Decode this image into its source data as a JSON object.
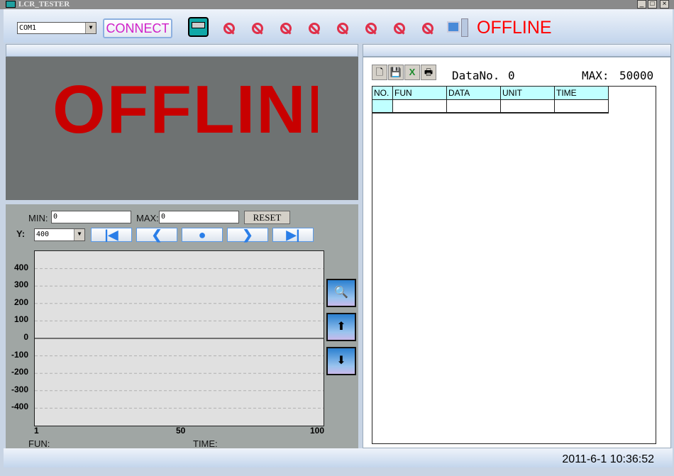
{
  "window": {
    "title": "LCR_TESTER",
    "minimize": "_",
    "maximize": "□",
    "close": "×"
  },
  "toolbar": {
    "port": "COM1",
    "connect_label": "CONNECT",
    "status": "OFFLINE",
    "icons": [
      "clock-icon",
      "no-sign-icon",
      "no-sign-icon",
      "no-sign-icon",
      "no-sign-icon",
      "no-sign-icon",
      "no-sign-icon",
      "no-sign-icon",
      "no-sign-icon",
      "computer-icon"
    ],
    "status_color": "#ff0000"
  },
  "display": {
    "text": "OFFLINE",
    "color": "#c80000"
  },
  "controls": {
    "min_label": "MIN:",
    "min_value": "0",
    "max_label": "MAX:",
    "max_value": "0",
    "reset_label": "RESET",
    "y_label": "Y:",
    "y_value": "400",
    "nav": [
      "first",
      "prev",
      "stop",
      "next",
      "last"
    ]
  },
  "chart_data": {
    "type": "line",
    "series": [],
    "yticks": [
      "400",
      "300",
      "200",
      "100",
      "0",
      "-100",
      "-200",
      "-300",
      "-400"
    ],
    "xticks": [
      "1",
      "50",
      "100"
    ],
    "ylim": [
      -500,
      500
    ],
    "xlim": [
      1,
      100
    ],
    "grid": true
  },
  "footer_left": {
    "fun_label": "FUN:",
    "time_label": "TIME:"
  },
  "right": {
    "datano_label": "DataNo.",
    "datano_value": "0",
    "max_label": "MAX:",
    "max_value": "50000",
    "columns": [
      "NO.",
      "FUN",
      "DATA",
      "UNIT",
      "TIME"
    ]
  },
  "status": {
    "datetime": "2011-6-1 10:36:52"
  }
}
